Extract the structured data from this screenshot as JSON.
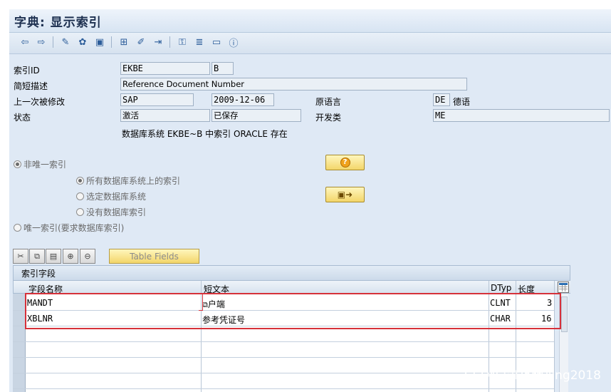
{
  "title": "字典: 显示索引",
  "toolbar": {
    "icons": [
      "back-arrow-icon",
      "forward-arrow-icon",
      "display-change-icon",
      "other-object-icon",
      "activate-icon",
      "where-used-icon",
      "check-icon",
      "transport-icon",
      "hierarchy-icon",
      "list-icon",
      "window-icon",
      "info-icon"
    ]
  },
  "fields": {
    "index_id_label": "索引ID",
    "index_table": "EKBE",
    "index_name": "B",
    "short_desc_label": "简短描述",
    "short_desc": "Reference Document Number",
    "last_changed_label": "上一次被修改",
    "changed_by": "SAP",
    "changed_date": "2009-12-06",
    "orig_lang_label": "原语言",
    "orig_lang_code": "DE",
    "orig_lang_name": "德语",
    "status_label": "状态",
    "status_active": "激活",
    "status_saved": "已保存",
    "package_label": "开发类",
    "package": "ME",
    "db_info": "数据库系统 EKBE~B 中索引 ORACLE 存在"
  },
  "radios": {
    "non_unique": "非唯一索引",
    "all_db": "所有数据库系统上的索引",
    "selected_db": "选定数据库系统",
    "no_db": "没有数据库索引",
    "unique": "唯一索引(要求数据库索引)"
  },
  "table": {
    "fields_button": "Table Fields",
    "title": "索引字段",
    "headers": [
      "字段名称",
      "短文本",
      "DTyp",
      "长度"
    ],
    "rows": [
      {
        "name": "MANDT",
        "text": "户端",
        "dtyp": "CLNT",
        "len": "3"
      },
      {
        "name": "XBLNR",
        "text": "参考凭证号",
        "dtyp": "CHAR",
        "len": "16"
      }
    ]
  },
  "watermark": "CSDN @Harryjing2018",
  "colors": {
    "highlight": "#d6313a",
    "button_yellow": "#f3d66a"
  }
}
